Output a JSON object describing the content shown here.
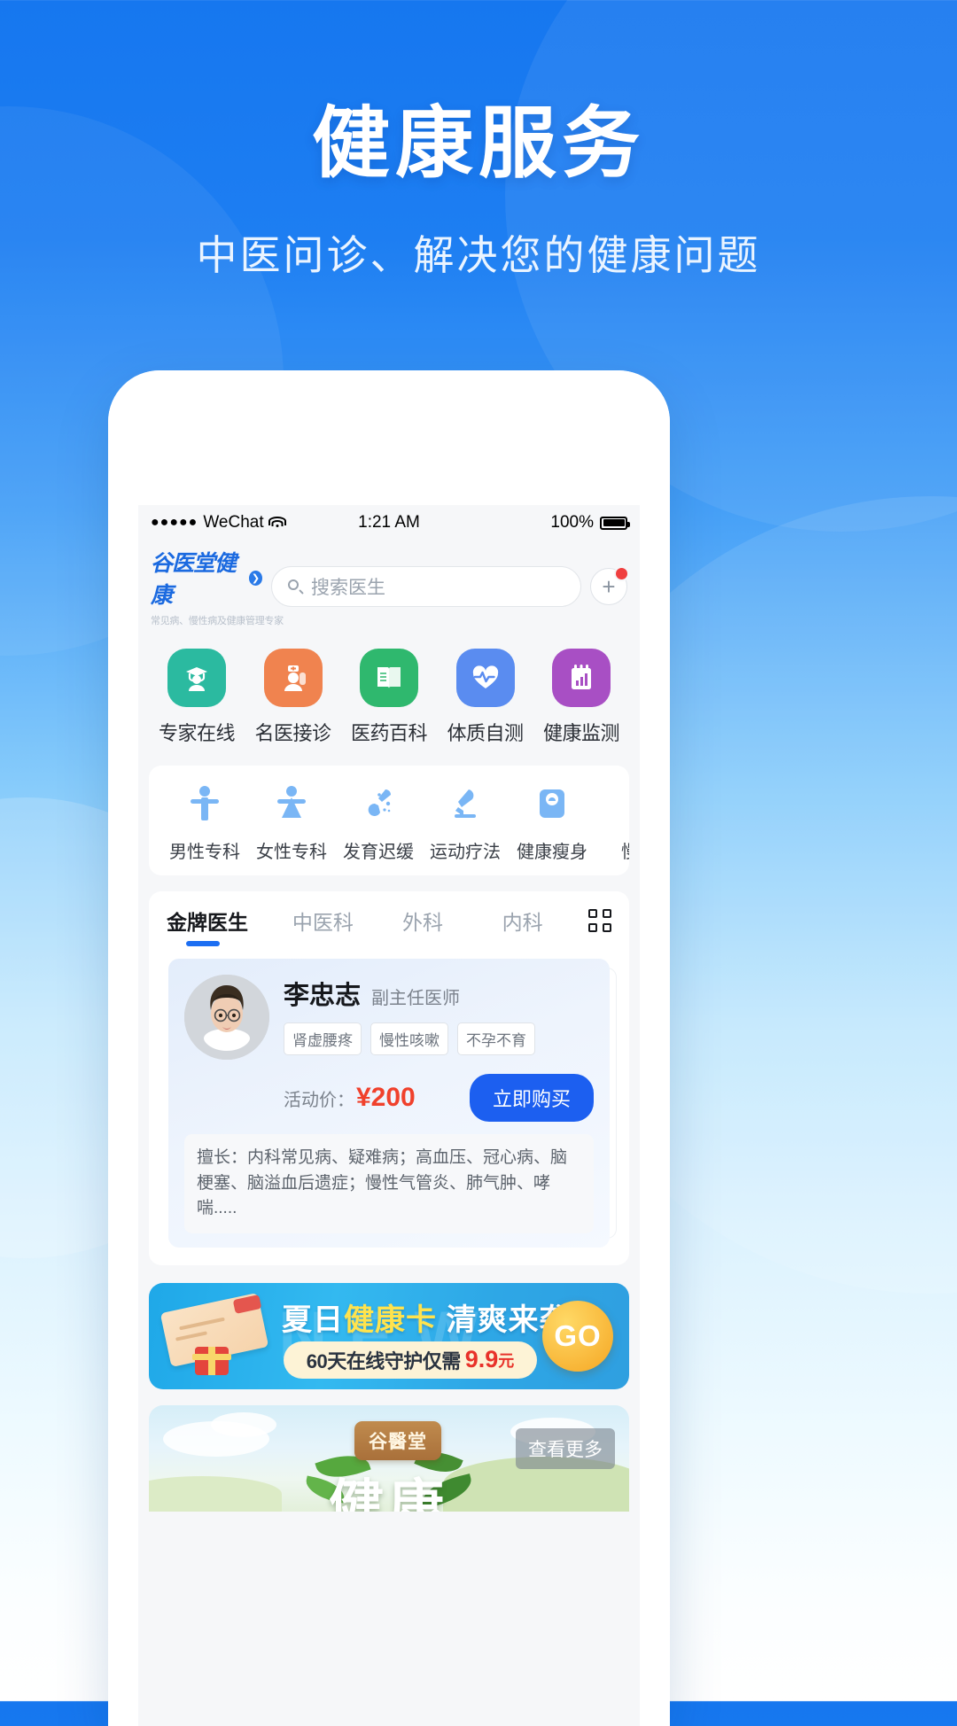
{
  "hero": {
    "title": "健康服务",
    "subtitle": "中医问诊、解决您的健康问题"
  },
  "status_bar": {
    "signal_dots": "●●●●●",
    "carrier": "WeChat",
    "wifi_icon": "wifi-icon",
    "time": "1:21 AM",
    "battery_percent": "100%",
    "battery_icon": "battery-full-icon"
  },
  "app_header": {
    "brand_name": "谷医堂健康",
    "brand_arrow_icon": "chevron-right-icon",
    "brand_tagline": "常见病、慢性病及健康管理专家",
    "search_icon": "search-icon",
    "search_placeholder": "搜索医生",
    "add_button_label": "+",
    "add_button_badge": ""
  },
  "quick_grid": [
    {
      "label": "专家在线",
      "icon": "graduate-doctor-icon",
      "color": "#2bbaa0"
    },
    {
      "label": "名医接诊",
      "icon": "doctor-badge-icon",
      "color": "#f0834f"
    },
    {
      "label": "医药百科",
      "icon": "book-icon",
      "color": "#2fb86e"
    },
    {
      "label": "体质自测",
      "icon": "heartbeat-icon",
      "color": "#5a8cf0"
    },
    {
      "label": "健康监测",
      "icon": "chart-clipboard-icon",
      "color": "#a84fc4"
    }
  ],
  "categories": [
    {
      "label": "男性专科",
      "icon": "male-figure-icon"
    },
    {
      "label": "女性专科",
      "icon": "female-figure-icon"
    },
    {
      "label": "发育迟缓",
      "icon": "growth-icon"
    },
    {
      "label": "运动疗法",
      "icon": "microscope-icon"
    },
    {
      "label": "健康瘦身",
      "icon": "scale-icon"
    },
    {
      "label": "慢病",
      "icon": "chronic-icon"
    }
  ],
  "tabs": {
    "items": [
      "金牌医生",
      "中医科",
      "外科",
      "内科"
    ],
    "active_index": 0,
    "grid_icon": "grid-menu-icon"
  },
  "doctor_card": {
    "avatar": "doctor-avatar",
    "name": "李忠志",
    "title": "副主任医师",
    "tags": [
      "肾虚腰疼",
      "慢性咳嗽",
      "不孕不育"
    ],
    "price_label": "活动价：",
    "price_value": "¥200",
    "buy_label": "立即购买",
    "description": "擅长：内科常见病、疑难病；高血压、冠心病、脑梗塞、脑溢血后遗症；慢性气管炎、肺气肿、哮喘....."
  },
  "promo_banner": {
    "ghost_text": "NEW",
    "headline_a": "夏日",
    "headline_b": "健康卡",
    "headline_c": "清爽来袭",
    "pill_text": "60天在线守护仅需",
    "pill_price": "9.9",
    "pill_unit": "元",
    "go_label": "GO",
    "card_icon": "health-card-icon",
    "gift_icon": "gift-icon"
  },
  "bottom_banner": {
    "plaque_text": "谷醫堂",
    "big_word": "健康",
    "view_more": "查看更多"
  },
  "colors": {
    "brand_blue": "#1b6ae0",
    "accent_blue": "#1c5ff0",
    "price_red": "#f0412c",
    "badge_red": "#f03f3f",
    "promo_yellow": "#ffe34d"
  }
}
